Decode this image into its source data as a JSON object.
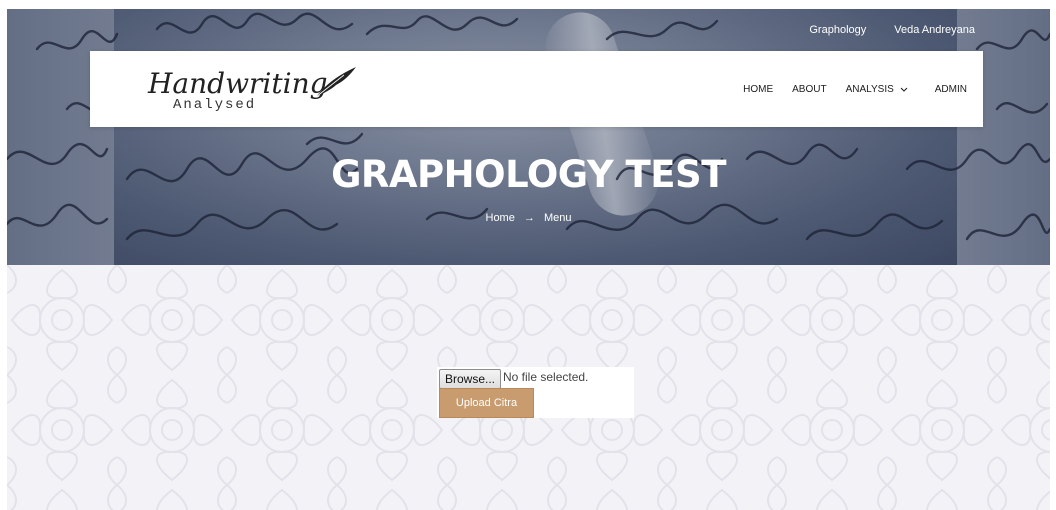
{
  "topbar": {
    "links": [
      "Graphology",
      "Veda Andreyana"
    ]
  },
  "logo": {
    "script": "Handwriting",
    "sub": "Analysed"
  },
  "nav": {
    "home": "HOME",
    "about": "ABOUT",
    "analysis": "ANALYSIS",
    "admin": "ADMIN"
  },
  "hero": {
    "title": "GRAPHOLOGY TEST",
    "crumb_home": "Home",
    "crumb_arrow": "→",
    "crumb_current": "Menu"
  },
  "upload": {
    "browse_label": "Browse...",
    "file_status": "No file selected.",
    "button_label": "Upload Citra"
  },
  "colors": {
    "accent": "#c99c6f",
    "lower_bg": "#f3f3f7"
  }
}
